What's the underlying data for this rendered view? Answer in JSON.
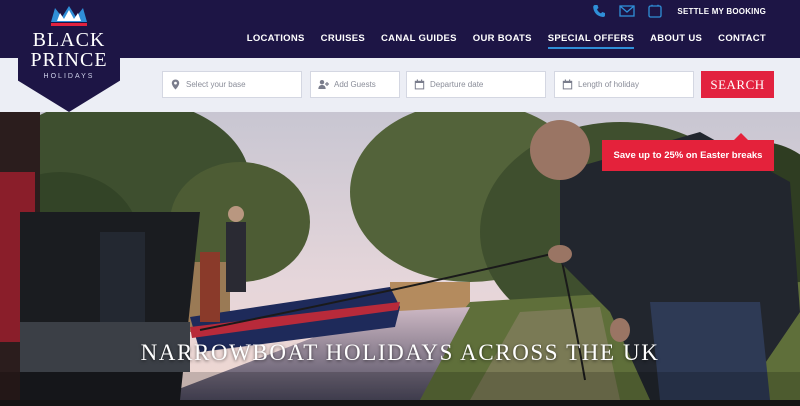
{
  "brand": {
    "line1": "BLACK",
    "line2": "PRINCE",
    "line3": "HOLIDAYS"
  },
  "header": {
    "utility": {
      "phone_icon": "phone-icon",
      "mail_icon": "mail-icon",
      "booking_icon": "booking-icon",
      "settle_label": "SETTLE MY BOOKING"
    },
    "nav": [
      {
        "label": "LOCATIONS"
      },
      {
        "label": "CRUISES"
      },
      {
        "label": "CANAL GUIDES"
      },
      {
        "label": "OUR BOATS"
      },
      {
        "label": "SPECIAL OFFERS",
        "active": true
      },
      {
        "label": "ABOUT US"
      },
      {
        "label": "CONTACT"
      }
    ]
  },
  "search": {
    "base_placeholder": "Select your base",
    "guests_placeholder": "Add Guests",
    "date_placeholder": "Departure date",
    "length_placeholder": "Length of holiday",
    "button_label": "SEARCH"
  },
  "hero": {
    "promo_text": "Save up to 25% on Easter breaks",
    "headline": "NARROWBOAT HOLIDAYS ACROSS THE UK"
  },
  "colors": {
    "navy": "#1d1545",
    "accent_red": "#e2223f",
    "active_underline": "#2f8fd8"
  }
}
